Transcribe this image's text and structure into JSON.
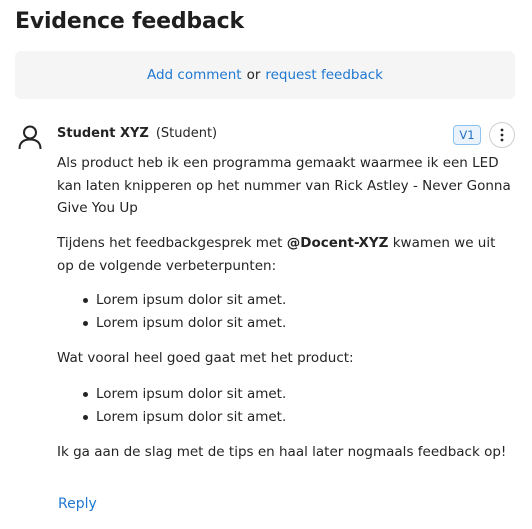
{
  "header": {
    "title": "Evidence feedback"
  },
  "actions": {
    "add_comment": "Add comment",
    "separator": "or",
    "request_feedback": "request feedback"
  },
  "comment": {
    "author": "Student XYZ",
    "role": "(Student)",
    "version": "V1",
    "avatar_icon": "person-icon",
    "more_icon": "vertical-ellipsis-icon",
    "paragraph1": "Als product heb ik een programma gemaakt waarmee ik een LED kan laten knipperen op het nummer van Rick Astley - Never Gonna Give You Up",
    "paragraph2_before": "Tijdens het feedbackgesprek met ",
    "mention": "@Docent-XYZ",
    "paragraph2_after": " kwamen we uit op de volgende verbeterpunten:",
    "list1": [
      "Lorem ipsum dolor sit amet.",
      "Lorem ipsum dolor sit amet."
    ],
    "paragraph3": "Wat vooral heel goed gaat met het product:",
    "list2": [
      "Lorem ipsum dolor sit amet.",
      "Lorem ipsum dolor sit amet."
    ],
    "paragraph4": "Ik ga aan de slag met de tips en haal later nogmaals feedback op!",
    "reply_label": "Reply"
  },
  "colors": {
    "link": "#1f78d1",
    "panel_bg": "#f5f5f5",
    "badge_border": "#8fc1ee",
    "badge_bg": "#eaf3fc"
  }
}
